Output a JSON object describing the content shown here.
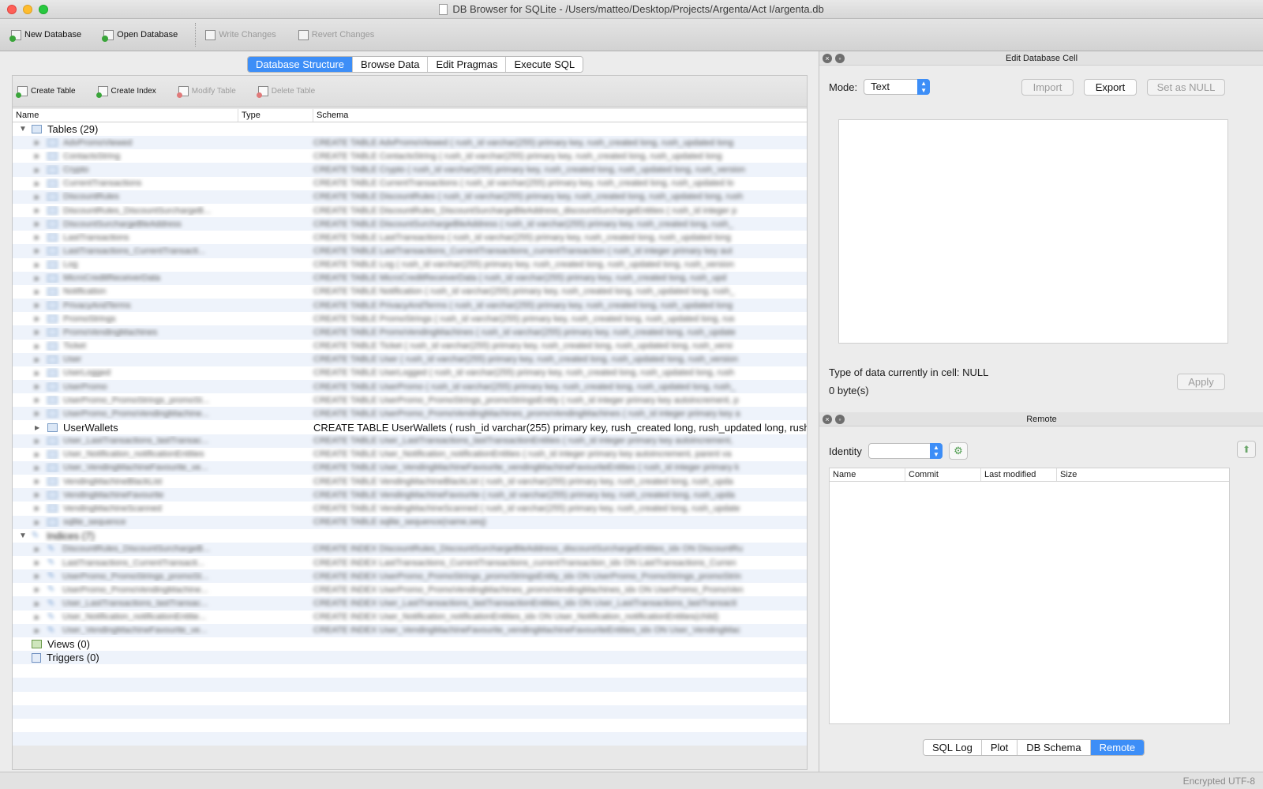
{
  "window": {
    "title": "DB Browser for SQLite - /Users/matteo/Desktop/Projects/Argenta/Act I/argenta.db"
  },
  "toolbar": {
    "new_database": "New Database",
    "open_database": "Open Database",
    "write_changes": "Write Changes",
    "revert_changes": "Revert Changes"
  },
  "main_tabs": [
    "Database Structure",
    "Browse Data",
    "Edit Pragmas",
    "Execute SQL"
  ],
  "active_main_tab": "Database Structure",
  "structure_toolbar": {
    "create_table": "Create Table",
    "create_index": "Create Index",
    "modify_table": "Modify Table",
    "delete_table": "Delete Table"
  },
  "tree": {
    "columns": [
      "Name",
      "Type",
      "Schema"
    ],
    "tables_label": "Tables (29)",
    "tables": [
      {
        "name": "AdvPromoViewed",
        "schema": "CREATE TABLE AdvPromoViewed ( rush_id varchar(255) primary key, rush_created long, rush_updated long",
        "blurred": true
      },
      {
        "name": "ContactsString",
        "schema": "CREATE TABLE ContactsString ( rush_id varchar(255) primary key, rush_created long, rush_updated long",
        "blurred": true
      },
      {
        "name": "Crypto",
        "schema": "CREATE TABLE Crypto ( rush_id varchar(255) primary key, rush_created long, rush_updated long, rush_version",
        "blurred": true
      },
      {
        "name": "CurrentTransactions",
        "schema": "CREATE TABLE CurrentTransactions ( rush_id varchar(255) primary key, rush_created long, rush_updated lo",
        "blurred": true
      },
      {
        "name": "DiscountRules",
        "schema": "CREATE TABLE DiscountRules ( rush_id varchar(255) primary key, rush_created long, rush_updated long, rush",
        "blurred": true
      },
      {
        "name": "DiscountRules_DiscountSurchargeB...",
        "schema": "CREATE TABLE DiscountRules_DiscountSurchargeBleAddress_discountSurchargeEntities ( rush_id integer p",
        "blurred": true
      },
      {
        "name": "DiscountSurchargeBleAddress",
        "schema": "CREATE TABLE DiscountSurchargeBleAddress ( rush_id varchar(255) primary key, rush_created long, rush_",
        "blurred": true
      },
      {
        "name": "LastTransactions",
        "schema": "CREATE TABLE LastTransactions ( rush_id varchar(255) primary key, rush_created long, rush_updated long",
        "blurred": true
      },
      {
        "name": "LastTransactions_CurrentTransacti...",
        "schema": "CREATE TABLE LastTransactions_CurrentTransactions_currentTransaction ( rush_id integer primary key aut",
        "blurred": true
      },
      {
        "name": "Log",
        "schema": "CREATE TABLE Log ( rush_id varchar(255) primary key, rush_created long, rush_updated long, rush_version",
        "blurred": true
      },
      {
        "name": "MicroCreditReceiverData",
        "schema": "CREATE TABLE MicroCreditReceiverData ( rush_id varchar(255) primary key, rush_created long, rush_upd",
        "blurred": true
      },
      {
        "name": "Notification",
        "schema": "CREATE TABLE Notification ( rush_id varchar(255) primary key, rush_created long, rush_updated long, rush_",
        "blurred": true
      },
      {
        "name": "PrivacyAndTerms",
        "schema": "CREATE TABLE PrivacyAndTerms ( rush_id varchar(255) primary key, rush_created long, rush_updated long",
        "blurred": true
      },
      {
        "name": "PromoStrings",
        "schema": "CREATE TABLE PromoStrings ( rush_id varchar(255) primary key, rush_created long, rush_updated long, rus",
        "blurred": true
      },
      {
        "name": "PromoVendingMachines",
        "schema": "CREATE TABLE PromoVendingMachines ( rush_id varchar(255) primary key, rush_created long, rush_update",
        "blurred": true
      },
      {
        "name": "Ticket",
        "schema": "CREATE TABLE Ticket ( rush_id varchar(255) primary key, rush_created long, rush_updated long, rush_versi",
        "blurred": true
      },
      {
        "name": "User",
        "schema": "CREATE TABLE User ( rush_id varchar(255) primary key, rush_created long, rush_updated long, rush_version",
        "blurred": true
      },
      {
        "name": "UserLogged",
        "schema": "CREATE TABLE UserLogged ( rush_id varchar(255) primary key, rush_created long, rush_updated long, rush",
        "blurred": true
      },
      {
        "name": "UserPromo",
        "schema": "CREATE TABLE UserPromo ( rush_id varchar(255) primary key, rush_created long, rush_updated long, rush_",
        "blurred": true
      },
      {
        "name": "UserPromo_PromoStrings_promoSt...",
        "schema": "CREATE TABLE UserPromo_PromoStrings_promoStringsEntity ( rush_id integer primary key autoincrement, p",
        "blurred": true
      },
      {
        "name": "UserPromo_PromoVendingMachine...",
        "schema": "CREATE TABLE UserPromo_PromoVendingMachines_promoVendingMachines ( rush_id integer primary key a",
        "blurred": true
      },
      {
        "name": "UserWallets",
        "schema": "CREATE TABLE UserWallets ( rush_id varchar(255) primary key, rush_created long, rush_updated long, rush",
        "blurred": false
      },
      {
        "name": "User_LastTransactions_lastTransac...",
        "schema": "CREATE TABLE User_LastTransactions_lastTransactionEntities ( rush_id integer primary key autoincrement,",
        "blurred": true
      },
      {
        "name": "User_Notification_notificationEntities",
        "schema": "CREATE TABLE User_Notification_notificationEntities ( rush_id integer primary key autoincrement, parent va",
        "blurred": true
      },
      {
        "name": "User_VendingMachineFavourite_ve...",
        "schema": "CREATE TABLE User_VendingMachineFavourite_vendingMachineFavouriteEntities ( rush_id integer primary k",
        "blurred": true
      },
      {
        "name": "VendingMachineBlackList",
        "schema": "CREATE TABLE VendingMachineBlackList ( rush_id varchar(255) primary key, rush_created long, rush_upda",
        "blurred": true
      },
      {
        "name": "VendingMachineFavourite",
        "schema": "CREATE TABLE VendingMachineFavourite ( rush_id varchar(255) primary key, rush_created long, rush_upda",
        "blurred": true
      },
      {
        "name": "VendingMachineScanned",
        "schema": "CREATE TABLE VendingMachineScanned ( rush_id varchar(255) primary key, rush_created long, rush_update",
        "blurred": true
      },
      {
        "name": "sqlite_sequence",
        "schema": "CREATE TABLE sqlite_sequence(name,seq)",
        "blurred": true
      }
    ],
    "indices_label": "Indices (7)",
    "indices": [
      {
        "name": "DiscountRules_DiscountSurchargeB...",
        "schema": "CREATE INDEX DiscountRules_DiscountSurchargeBleAddress_discountSurchargeEntities_idx ON DiscountRu"
      },
      {
        "name": "LastTransactions_CurrentTransacti...",
        "schema": "CREATE INDEX LastTransactions_CurrentTransactions_currentTransaction_idx ON LastTransactions_Curren"
      },
      {
        "name": "UserPromo_PromoStrings_promoSt...",
        "schema": "CREATE INDEX UserPromo_PromoStrings_promoStringsEntity_idx ON UserPromo_PromoStrings_promoStrin"
      },
      {
        "name": "UserPromo_PromoVendingMachine...",
        "schema": "CREATE INDEX UserPromo_PromoVendingMachines_promoVendingMachines_idx ON UserPromo_PromoVen"
      },
      {
        "name": "User_LastTransactions_lastTransac...",
        "schema": "CREATE INDEX User_LastTransactions_lastTransactionEntities_idx ON User_LastTransactions_lastTransacti"
      },
      {
        "name": "User_Notification_notificationEntitie...",
        "schema": "CREATE INDEX User_Notification_notificationEntities_idx ON User_Notification_notificationEntities(child)"
      },
      {
        "name": "User_VendingMachineFavourite_ve...",
        "schema": "CREATE INDEX User_VendingMachineFavourite_vendingMachineFavouriteEntities_idx ON User_VendingMac"
      }
    ],
    "views_label": "Views (0)",
    "triggers_label": "Triggers (0)"
  },
  "edit_cell": {
    "title": "Edit Database Cell",
    "mode_label": "Mode:",
    "mode_value": "Text",
    "import": "Import",
    "export": "Export",
    "set_null": "Set as NULL",
    "type_info": "Type of data currently in cell: NULL",
    "size_info": "0 byte(s)",
    "apply": "Apply"
  },
  "remote": {
    "title": "Remote",
    "identity_label": "Identity",
    "identity_value": "",
    "columns": [
      "Name",
      "Commit",
      "Last modified",
      "Size"
    ]
  },
  "bottom_tabs": [
    "SQL Log",
    "Plot",
    "DB Schema",
    "Remote"
  ],
  "active_bottom_tab": "Remote",
  "status": {
    "encryption": "Encrypted",
    "encoding": "UTF-8"
  },
  "colors": {
    "accent": "#3d8ef7",
    "close": "#fe5f57",
    "minimize": "#febc2e",
    "maximize": "#28c840"
  }
}
